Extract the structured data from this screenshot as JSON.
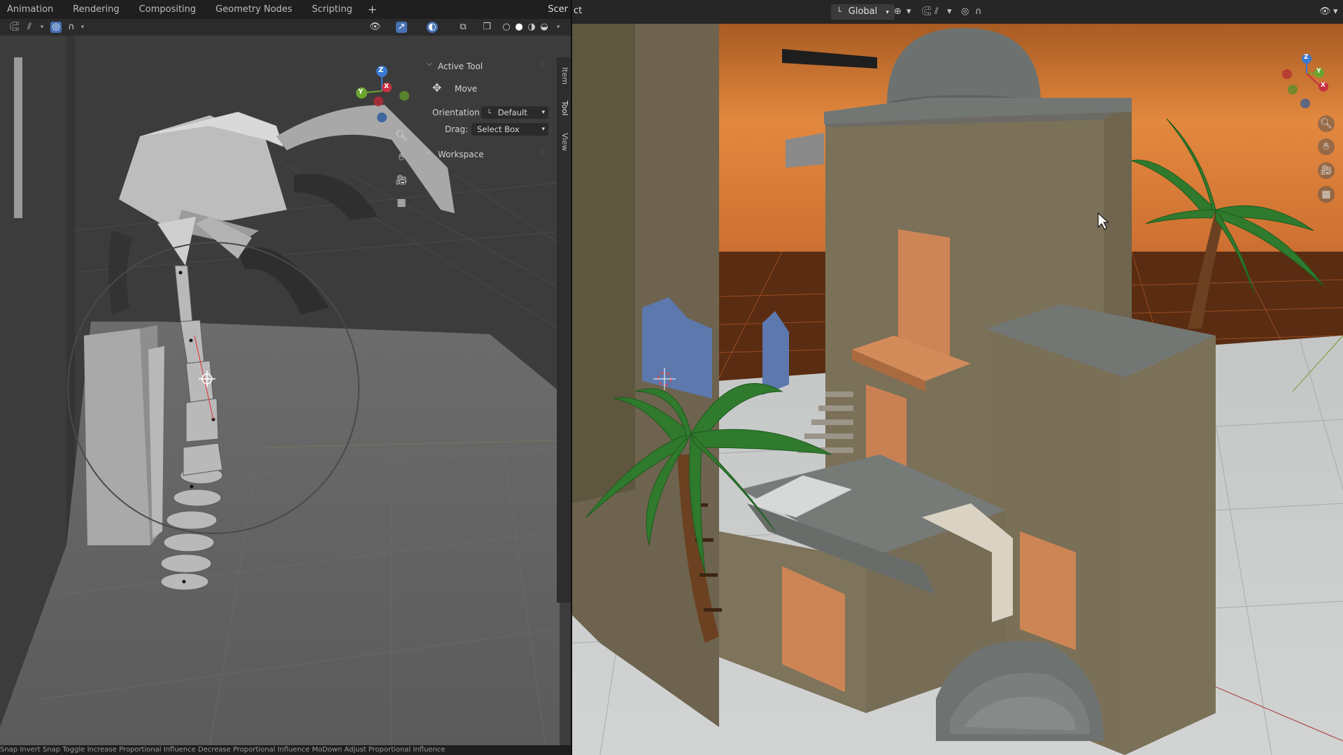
{
  "workspace_tabs": [
    "Animation",
    "Rendering",
    "Compositing",
    "Geometry Nodes",
    "Scripting"
  ],
  "workspace_add": "+",
  "scene_label": "Scer",
  "right_header_left_text": "ct",
  "transform_orientation": "Global",
  "n_panel": {
    "active_tool_heading": "Active Tool",
    "tool_name": "Move",
    "orientation_label": "Orientation",
    "orientation_value": "Default",
    "drag_label": "Drag:",
    "drag_value": "Select Box",
    "workspace_heading": "Workspace"
  },
  "sidebar_tabs": [
    "Item",
    "Tool",
    "View"
  ],
  "gizmo_axes": [
    "Z",
    "Y",
    "X"
  ],
  "status_bar": "Snap Invert    Snap Toggle    Increase Proportional Influence    Decrease Proportional Influence    MoDown Adjust Proportional Influence",
  "colors": {
    "sky_orange": "#e0853f",
    "wall": "#7d7158",
    "door": "#cd8556",
    "window": "#5d78ad",
    "palm_leaf": "#2f7a2d",
    "palm_trunk": "#6b4122",
    "roof_grey": "#6f7471"
  }
}
